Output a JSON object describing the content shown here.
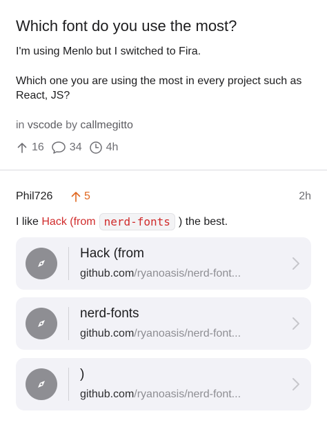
{
  "post": {
    "title": "Which font do you use the most?",
    "body_line_1": "I'm using Menlo but I switched to Fira.",
    "body_line_2": "Which one you are using the most in every project such as React, JS?",
    "meta_in": "in",
    "subreddit": "vscode",
    "meta_by": "by",
    "author": "callmegitto",
    "upvotes": "16",
    "comments": "34",
    "age": "4h"
  },
  "comment": {
    "author": "Phil726",
    "votes": "5",
    "time": "2h",
    "text_prefix": "I like",
    "link_text": "Hack (from",
    "code_text": "nerd-fonts",
    "text_suffix": ") the best."
  },
  "links": [
    {
      "title": "Hack (from",
      "domain": "github.com",
      "path": "/ryanoasis/nerd-font..."
    },
    {
      "title": "nerd-fonts",
      "domain": "github.com",
      "path": "/ryanoasis/nerd-font..."
    },
    {
      "title": ")",
      "domain": "github.com",
      "path": "/ryanoasis/nerd-font..."
    }
  ],
  "colors": {
    "accent_orange": "#e0661e",
    "link_red": "#d02b2b",
    "card_bg": "#f2f2f7",
    "icon_gray": "#8e8e93"
  },
  "icons": {
    "upvote": "arrow-up-icon",
    "comments": "speech-bubble-icon",
    "age": "clock-icon",
    "link": "safari-compass-icon",
    "chevron": "chevron-right-icon"
  }
}
